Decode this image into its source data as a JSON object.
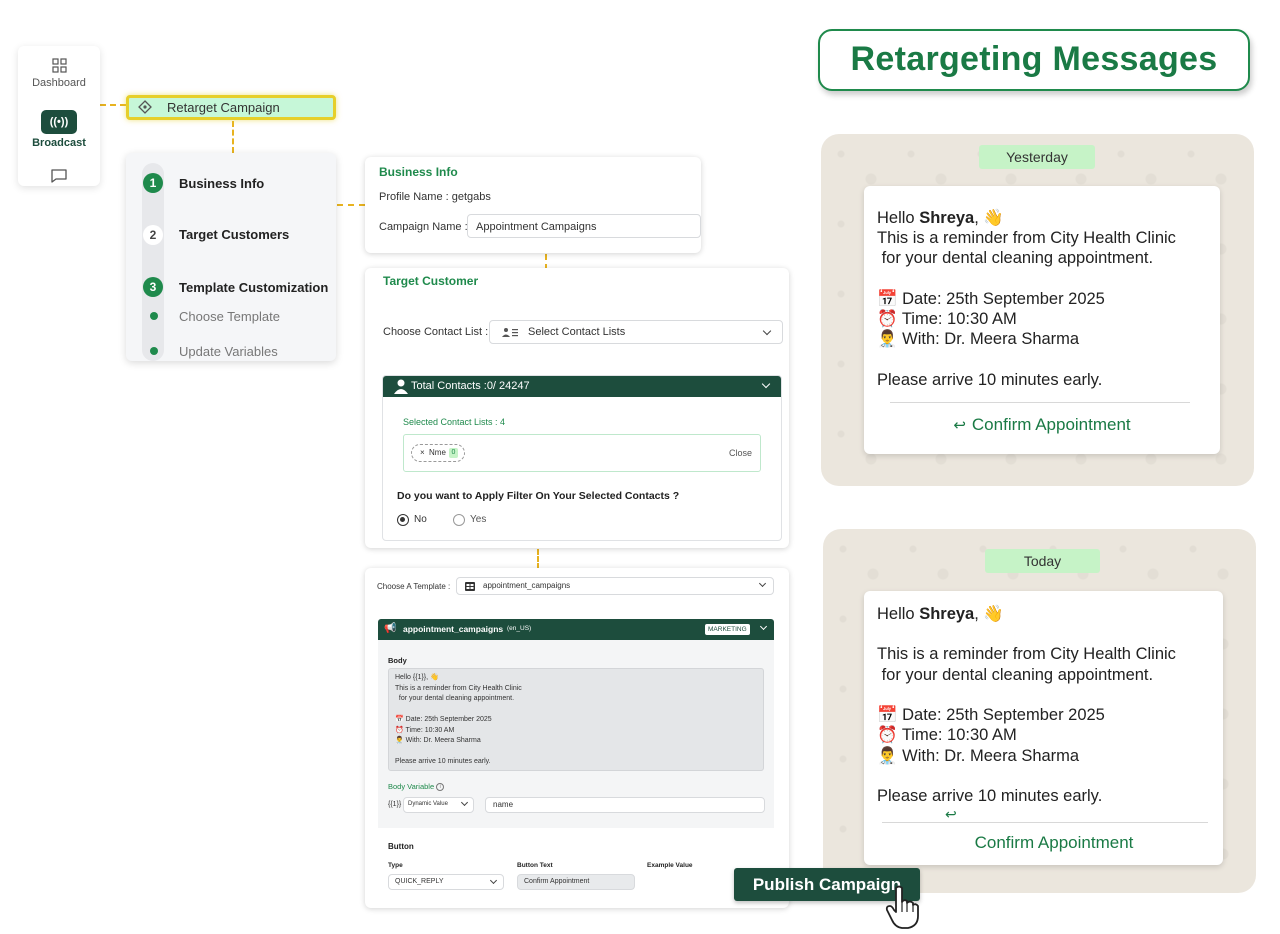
{
  "nav": {
    "items": [
      {
        "label": "Dashboard"
      },
      {
        "label": "Broadcast"
      }
    ],
    "broadcast_icon": "((•))"
  },
  "retarget_pill": {
    "label": "Retarget Campaign"
  },
  "steps": [
    {
      "num": "1",
      "label": "Business Info"
    },
    {
      "num": "2",
      "label": "Target Customers"
    },
    {
      "num": "3",
      "label": "Template Customization"
    }
  ],
  "substeps": [
    "Choose Template",
    "Update Variables"
  ],
  "business_info": {
    "title": "Business Info",
    "profile_label": "Profile Name : getgabs",
    "campaign_label": "Campaign Name :",
    "campaign_value": "Appointment Campaigns"
  },
  "target_customer": {
    "title": "Target Customer",
    "contact_list_label": "Choose Contact List :",
    "contact_list_value": "Select Contact Lists",
    "total_contacts": "Total Contacts :0/ 24247",
    "selected_lists": "Selected Contact Lists : 4",
    "chip_x": "×",
    "chip_label": "Nme",
    "chip_count": "0",
    "close_label": "Close",
    "filter_question": "Do you want to Apply Filter On Your Selected Contacts ?",
    "option_no": "No",
    "option_yes": "Yes"
  },
  "template": {
    "choose_label": "Choose A Template :",
    "choose_value": "appointment_campaigns",
    "name": "appointment_campaigns",
    "lang": "(en_US)",
    "badge": "MARKETING",
    "body_label": "Body",
    "body_lines": [
      "Hello {{1}}, 👋",
      "This is a reminder from City Health Clinic",
      "  for your dental cleaning appointment.",
      "",
      "📅 Date: 25th September 2025",
      "⏰ Time: 10:30 AM",
      "👨‍⚕️ With: Dr. Meera Sharma",
      "",
      "Please arrive 10 minutes early."
    ],
    "body_variable_label": "Body Variable",
    "var_placeholder": "{{1}}",
    "var_type": "Dynamic Value",
    "var_value": "name",
    "button_section": "Button",
    "type_label": "Type",
    "type_value": "QUICK_REPLY",
    "button_text_label": "Button Text",
    "button_text_value": "Confirm Appointment",
    "example_label": "Example Value"
  },
  "publish_button": "Publish Campaign",
  "title": "Retargeting Messages",
  "chat1": {
    "day": "Yesterday",
    "hello": "Hello ",
    "name": "Shreya",
    "wave": ", 👋",
    "lines": "This is a reminder from City Health Clinic\n for your dental cleaning appointment.\n\n📅 Date: 25th September 2025\n⏰ Time: 10:30 AM\n👨‍⚕️ With: Dr. Meera Sharma\n\nPlease arrive 10 minutes early.",
    "cta": "Confirm Appointment"
  },
  "chat2": {
    "day": "Today",
    "hello": "Hello ",
    "name": "Shreya",
    "wave": ", 👋",
    "lines": "\nThis is a reminder from City Health Clinic\n for your dental cleaning appointment.\n\n📅 Date: 25th September 2025\n⏰ Time: 10:30 AM\n👨‍⚕️ With: Dr. Meera Sharma\n\nPlease arrive 10 minutes early.",
    "cta": "Confirm Appointment"
  },
  "colors": {
    "brand_green": "#1f8a4c",
    "dark_green": "#1d4d3d",
    "connector": "#e8b320"
  }
}
